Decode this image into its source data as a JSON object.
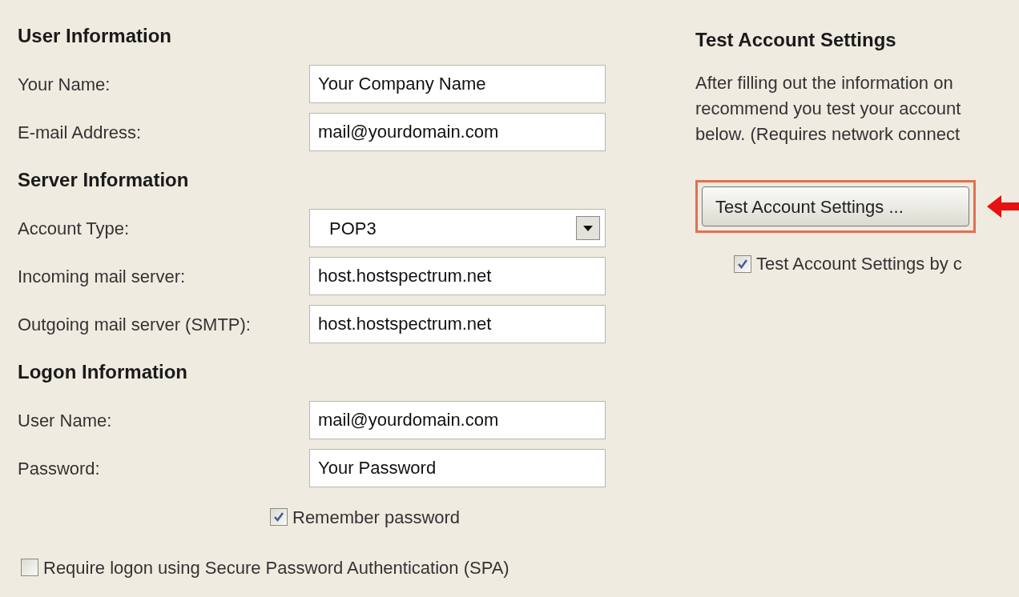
{
  "sections": [
    {
      "heading": "User Information",
      "fields": [
        {
          "label": "Your Name:",
          "kind": "text",
          "value": "Your Company Name"
        },
        {
          "label": "E-mail Address:",
          "kind": "text",
          "value": "mail@yourdomain.com"
        }
      ]
    },
    {
      "heading": "Server Information",
      "fields": [
        {
          "label": "Account Type:",
          "kind": "dropdown",
          "value": "POP3"
        },
        {
          "label": "Incoming mail server:",
          "kind": "text",
          "value": "host.hostspectrum.net"
        },
        {
          "label": "Outgoing mail server (SMTP):",
          "kind": "text",
          "value": "host.hostspectrum.net"
        }
      ]
    },
    {
      "heading": "Logon Information",
      "fields": [
        {
          "label": "User Name:",
          "kind": "text",
          "value": "mail@yourdomain.com"
        },
        {
          "label": "Password:",
          "kind": "text",
          "value": "Your Password"
        }
      ]
    }
  ],
  "remember_password": {
    "label": "Remember password",
    "checked": true
  },
  "require_spa": {
    "label": "Require logon using Secure Password Authentication (SPA)",
    "checked": false
  },
  "test_panel": {
    "heading": "Test Account Settings",
    "description_lines": [
      "After filling out the information on",
      "recommend you test your account",
      "below. (Requires network connect"
    ],
    "button": {
      "label": "Test Account Settings ...",
      "highlighted": true
    },
    "checkbox": {
      "label": "Test Account Settings by c",
      "checked": true
    }
  }
}
